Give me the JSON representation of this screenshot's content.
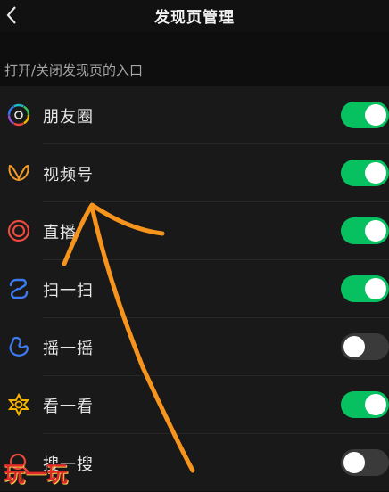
{
  "header": {
    "title": "发现页管理",
    "back_icon": "chevron-left-icon"
  },
  "section": {
    "title": "打开/关闭发现页的入口"
  },
  "entries": [
    {
      "label": "朋友圈",
      "icon": "moments-icon",
      "enabled": true
    },
    {
      "label": "视频号",
      "icon": "channels-icon",
      "enabled": true
    },
    {
      "label": "直播",
      "icon": "live-icon",
      "enabled": true
    },
    {
      "label": "扫一扫",
      "icon": "scan-icon",
      "enabled": true
    },
    {
      "label": "摇一摇",
      "icon": "shake-icon",
      "enabled": false
    },
    {
      "label": "看一看",
      "icon": "top-stories-icon",
      "enabled": true
    },
    {
      "label": "搜一搜",
      "icon": "search-icon",
      "enabled": false
    }
  ],
  "colors": {
    "toggle_on": "#07c160",
    "toggle_off": "#3a3a3a",
    "annotation_arrow": "#f7941d"
  },
  "watermark": "玩一玩"
}
